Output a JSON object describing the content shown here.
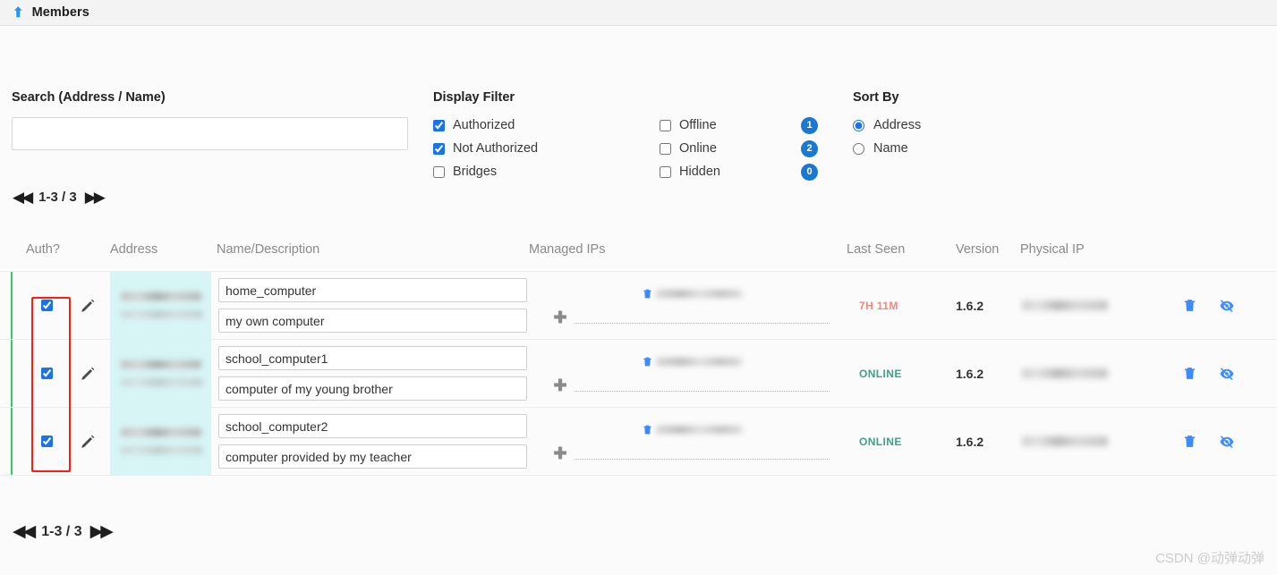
{
  "header": {
    "title": "Members",
    "arrow_icon": "arrow-up-icon"
  },
  "search": {
    "label": "Search (Address / Name)",
    "value": "",
    "placeholder": ""
  },
  "display_filter": {
    "label": "Display Filter",
    "column_one": [
      {
        "label": "Authorized",
        "checked": true
      },
      {
        "label": "Not Authorized",
        "checked": true
      },
      {
        "label": "Bridges",
        "checked": false
      }
    ],
    "column_two": [
      {
        "label": "Offline",
        "checked": false,
        "count": "1"
      },
      {
        "label": "Online",
        "checked": false,
        "count": "2"
      },
      {
        "label": "Hidden",
        "checked": false,
        "count": "0"
      }
    ]
  },
  "sort_by": {
    "label": "Sort By",
    "options": [
      {
        "label": "Address",
        "selected": true
      },
      {
        "label": "Name",
        "selected": false
      }
    ]
  },
  "pager": {
    "prev_icon": "skip-previous-icon",
    "next_icon": "skip-next-icon",
    "text": "1-3 / 3"
  },
  "table": {
    "headers": {
      "auth": "Auth?",
      "address": "Address",
      "name": "Name/Description",
      "managed_ips": "Managed IPs",
      "last_seen": "Last Seen",
      "version": "Version",
      "physical_ip": "Physical IP"
    },
    "rows": [
      {
        "authorized": true,
        "name": "home_computer",
        "description": "my own computer",
        "last_seen": "7H 11M",
        "last_seen_state": "offline",
        "version": "1.6.2"
      },
      {
        "authorized": true,
        "name": "school_computer1",
        "description": "computer of my young brother",
        "last_seen": "ONLINE",
        "last_seen_state": "online",
        "version": "1.6.2"
      },
      {
        "authorized": true,
        "name": "school_computer2",
        "description": "computer provided by my teacher",
        "last_seen": "ONLINE",
        "last_seen_state": "online",
        "version": "1.6.2"
      }
    ]
  },
  "colors": {
    "accent_blue": "#1878d4",
    "icon_blue": "#3d8bfd",
    "row_marker_green": "#3fc66a",
    "address_cell_bg": "#d7f5f5",
    "annotation_red": "#fb1d12",
    "online_green": "#3fa18b",
    "offline_red": "#f4877d"
  },
  "watermark": {
    "text": "CSDN @动弹动弹"
  }
}
